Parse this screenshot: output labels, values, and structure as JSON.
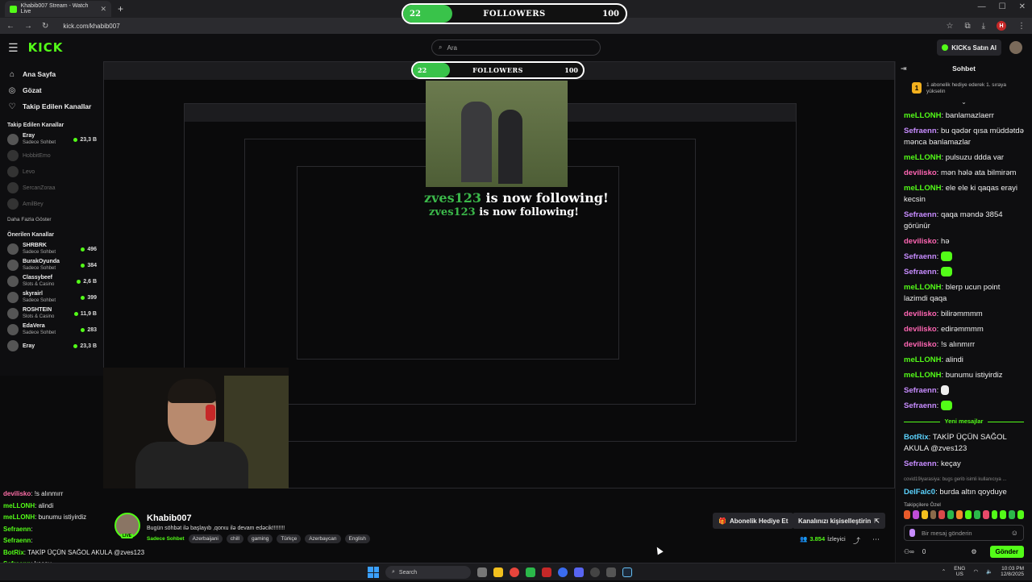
{
  "browser": {
    "tab_title": "Khabib007 Stream - Watch Live",
    "url": "kick.com/khabib007",
    "new_tab": "+",
    "profile_letter": "H"
  },
  "overlay": {
    "followers_label": "FOLLOWERS",
    "followers_current": "22",
    "followers_goal": "100",
    "followers_progress": 0.22,
    "follow_alert_user": "zves123",
    "follow_alert_text": "is now following!"
  },
  "topnav": {
    "search_placeholder": "Ara",
    "buy_kicks": "KICKs Satın Al",
    "logo": "KICK"
  },
  "sidebar": {
    "nav": [
      {
        "label": "Ana Sayfa",
        "icon": "home-icon"
      },
      {
        "label": "Gözat",
        "icon": "compass-icon"
      },
      {
        "label": "Takip Edilen Kanallar",
        "icon": "heart-icon"
      }
    ],
    "followed_title": "Takip Edilen Kanallar",
    "followed": [
      {
        "name": "Eray",
        "category": "Sadece Sohbet",
        "viewers": "23,3 B",
        "live": true
      },
      {
        "name": "HobbitEmo",
        "live": false
      },
      {
        "name": "Levo",
        "live": false
      },
      {
        "name": "SercanZoraa",
        "live": false
      },
      {
        "name": "AmilBey",
        "live": false
      }
    ],
    "show_more": "Daha Fazla Göster",
    "recommended_title": "Önerilen Kanallar",
    "recommended": [
      {
        "name": "SHRBRK",
        "category": "Sadece Sohbet",
        "viewers": "496"
      },
      {
        "name": "BurakOyunda",
        "category": "Sadece Sohbet",
        "viewers": "384"
      },
      {
        "name": "Classybeef",
        "category": "Slots & Casino",
        "viewers": "2,6 B"
      },
      {
        "name": "skyrairl",
        "category": "Sadece Sohbet",
        "viewers": "399"
      },
      {
        "name": "ROSHTEIN",
        "category": "Slots & Casino",
        "viewers": "11,9 B"
      },
      {
        "name": "EdaVera",
        "category": "Sadece Sohbet",
        "viewers": "283"
      },
      {
        "name": "Eray",
        "category": "",
        "viewers": "23,3 B"
      }
    ]
  },
  "mini_chat": [
    {
      "user": "devilisko",
      "text": "!s alınmırr",
      "color": "pink"
    },
    {
      "user": "meLLONH",
      "text": "alindi",
      "color": "green"
    },
    {
      "user": "meLLONH",
      "text": "bunumu istiyirdiz",
      "color": "green"
    },
    {
      "user": "Sefraenn",
      "text": "",
      "color": "green"
    },
    {
      "user": "Sefraenn",
      "text": "",
      "color": "green"
    },
    {
      "user": "BotRix",
      "text": "TAKİP ÜÇÜN SAĞOL AKULA @zves123",
      "color": "green"
    },
    {
      "user": "Sefraenn",
      "text": "keçay",
      "color": "green"
    },
    {
      "user": "DelFalc0",
      "text": "burda altın qoyduye",
      "color": "green"
    }
  ],
  "channel": {
    "name": "Khabib007",
    "title": "Bugün söhbət ilə başlayıb ,qorxu ilə devam edəcik!!!!!!!!",
    "category": "Sadece Sohbet",
    "tags": [
      "Azerbaijani",
      "chill",
      "gaming",
      "Türkçe",
      "Azerbaycan",
      "English"
    ],
    "live_badge": "LIVE",
    "subscribe_gift": "Abonelik Hediye Et",
    "customize": "Kanalınızı kişiselleştirin",
    "viewers_count": "3.854",
    "viewers_label": "İzleyici"
  },
  "chat": {
    "title": "Sohbet",
    "pinned_text": "1 abonelik hediye ederek 1. sıraya yükselin",
    "pinned_rank": "1",
    "messages": [
      {
        "user": "meLLONH",
        "text": "banlamazlaerr",
        "color": "green"
      },
      {
        "user": "Sefraenn",
        "text": "bu qədər qısa müddətdə mənca banlamazlar",
        "color": "purple"
      },
      {
        "user": "meLLONH",
        "text": "pulsuzu ddda var",
        "color": "green"
      },
      {
        "user": "devilisko",
        "text": "mən hələ ata bilmirəm",
        "color": "pink"
      },
      {
        "user": "meLLONH",
        "text": "ele ele ki qaqas erayi kecsin",
        "color": "green"
      },
      {
        "user": "Sefraenn",
        "text": "qaqa məndə 3854 görünür",
        "color": "purple"
      },
      {
        "user": "devilisko",
        "text": "hə",
        "color": "pink"
      },
      {
        "user": "Sefraenn",
        "text": "",
        "color": "purple",
        "emote": true
      },
      {
        "user": "Sefraenn",
        "text": "",
        "color": "purple",
        "emote": true
      },
      {
        "user": "meLLONH",
        "text": "blerp ucun point lazimdi qaqa",
        "color": "green"
      },
      {
        "user": "devilisko",
        "text": "bilirəmmmm",
        "color": "pink"
      },
      {
        "user": "devilisko",
        "text": "edirəmmmm",
        "color": "pink"
      },
      {
        "user": "devilisko",
        "text": "!s alınmırr",
        "color": "pink"
      },
      {
        "user": "meLLONH",
        "text": "alindi",
        "color": "green"
      },
      {
        "user": "meLLONH",
        "text": "bunumu istiyirdiz",
        "color": "green"
      },
      {
        "user": "Sefraenn",
        "text": "",
        "color": "purple",
        "hand": true
      },
      {
        "user": "Sefraenn",
        "text": "",
        "color": "purple",
        "emote": true
      }
    ],
    "new_messages": "Yeni mesajlar",
    "after_messages": [
      {
        "user": "BotRix",
        "text": "TAKİP ÜÇÜN SAĞOL AKULA @zves123",
        "color": "cyan"
      },
      {
        "user": "Sefraenn",
        "text": "keçay",
        "color": "purple"
      }
    ],
    "reply_note": "covid19iyarasiya: bugs gerib isimli kullanıcıya ...",
    "last_message": {
      "user": "DelFalc0",
      "text": "burda altın qoyduye",
      "color": "cyan"
    },
    "emote_section": "Takipçilere Özel",
    "emote_colors": [
      "#e85a2a",
      "#c04dd8",
      "#f2c01e",
      "#8a6a4a",
      "#d84a4a",
      "#2bb84a",
      "#f28a2a",
      "#53fc18",
      "#2bb84a",
      "#e84a6a",
      "#53fc18",
      "#53fc18",
      "#2bb84a",
      "#53fc18"
    ],
    "input_placeholder": "Bir mesaj gönderin",
    "points": "0",
    "send": "Gönder"
  },
  "taskbar": {
    "search": "Search",
    "lang_1": "ENG",
    "lang_2": "US",
    "time": "10:03 PM",
    "date": "12/8/2025"
  }
}
